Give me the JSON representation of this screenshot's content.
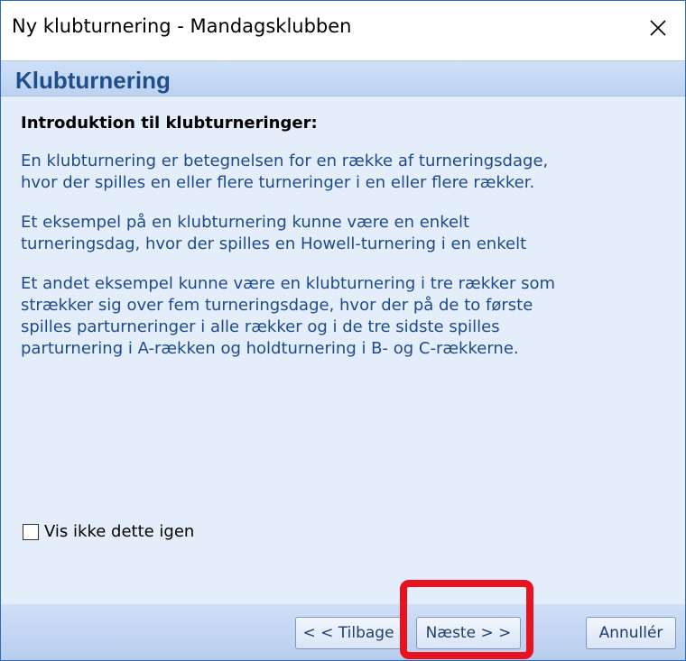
{
  "window": {
    "title": "Ny klubturnering - Mandagsklubben",
    "close_icon": "close-icon"
  },
  "header": {
    "heading": "Klubturnering"
  },
  "main": {
    "intro_title": "Introduktion til klubturneringer:",
    "paragraphs": [
      {
        "lines": [
          "En klubturnering er betegnelsen for en række af turneringsdage,",
          "hvor der spilles en eller flere turneringer i en eller flere rækker."
        ]
      },
      {
        "lines": [
          "Et eksempel på en klubturnering kunne være en enkelt",
          "turneringsdag, hvor der spilles en Howell-turnering i en enkelt"
        ]
      },
      {
        "lines": [
          "Et andet eksempel kunne være en klubturnering i tre rækker som",
          "strækker sig over fem turneringsdage, hvor der på de to første",
          "spilles parturneringer i alle rækker og i de tre sidste spilles",
          "parturnering i A-rækken og holdturnering i B- og C-rækkerne."
        ]
      }
    ],
    "checkbox": {
      "label": "Vis ikke dette igen",
      "checked": false
    }
  },
  "footer": {
    "back_label": "< < Tilbage",
    "next_label": "Næste > >",
    "cancel_label": "Annullér"
  },
  "colors": {
    "accent_heading": "#1f4e8c",
    "body_text": "#1f4a8a",
    "content_bg": "#e4eefb",
    "highlight": "#e8131f"
  }
}
